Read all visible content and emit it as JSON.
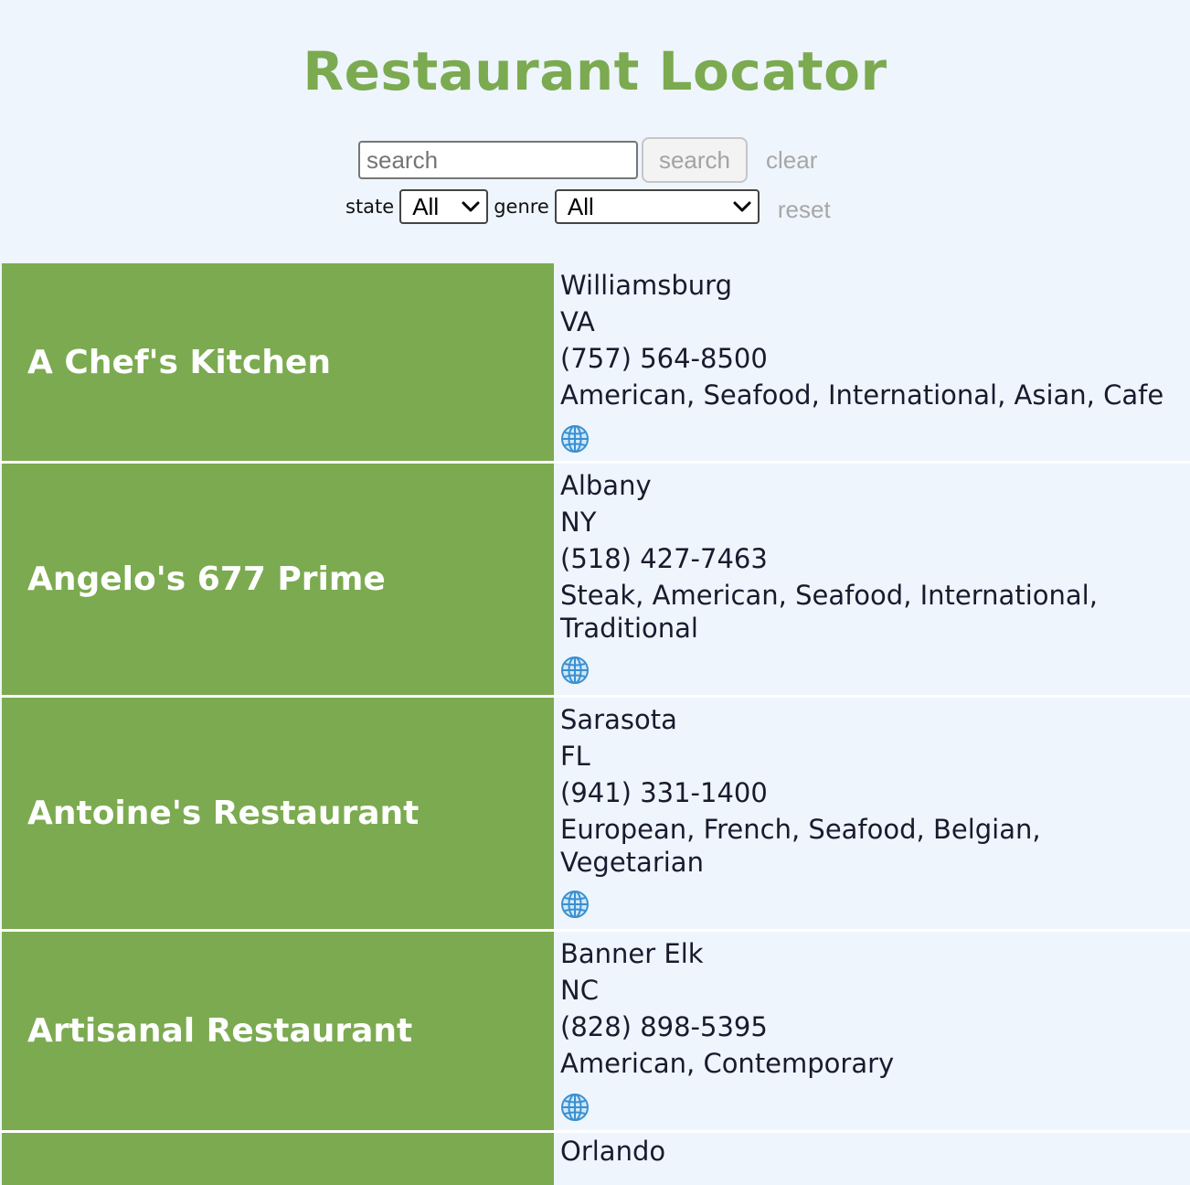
{
  "header": {
    "title": "Restaurant Locator"
  },
  "search": {
    "placeholder": "search",
    "value": "",
    "button_label": "search",
    "clear_label": "clear"
  },
  "filters": {
    "state_label": "state",
    "state_value": "All",
    "genre_label": "genre",
    "genre_value": "All",
    "reset_label": "reset"
  },
  "restaurants": [
    {
      "name": "A Chef's Kitchen",
      "city": "Williamsburg",
      "state": "VA",
      "phone": "(757) 564-8500",
      "genres": "American, Seafood, International, Asian, Cafe",
      "website_icon": "globe-icon"
    },
    {
      "name": "Angelo's 677 Prime",
      "city": "Albany",
      "state": "NY",
      "phone": "(518) 427-7463",
      "genres": "Steak, American, Seafood, International, Traditional",
      "website_icon": "globe-icon"
    },
    {
      "name": "Antoine's Restaurant",
      "city": "Sarasota",
      "state": "FL",
      "phone": "(941) 331-1400",
      "genres": "European, French, Seafood, Belgian, Vegetarian",
      "website_icon": "globe-icon"
    },
    {
      "name": "Artisanal Restaurant",
      "city": "Banner Elk",
      "state": "NC",
      "phone": "(828) 898-5395",
      "genres": "American, Contemporary",
      "website_icon": "globe-icon"
    },
    {
      "name": "",
      "city": "Orlando"
    }
  ],
  "colors": {
    "background": "#eef5fd",
    "accent": "#7baa50",
    "text": "#1a1a2e",
    "muted": "#a7a7a7"
  }
}
